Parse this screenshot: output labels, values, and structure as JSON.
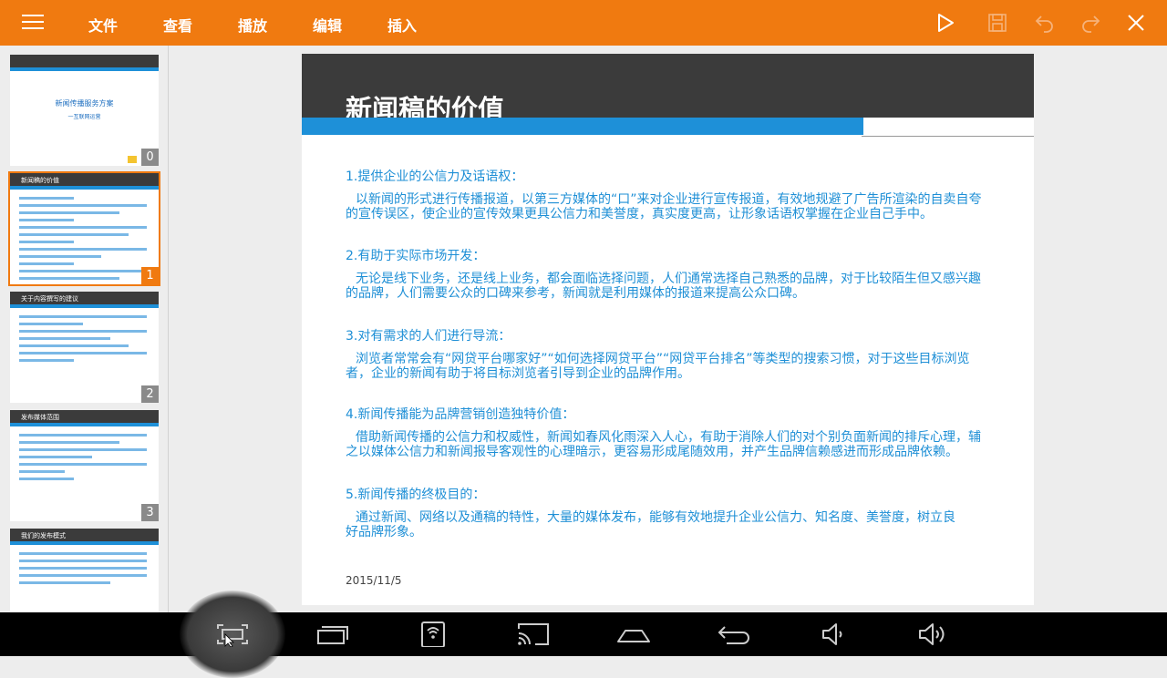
{
  "menu": {
    "items": [
      "文件",
      "查看",
      "播放",
      "编辑",
      "插入"
    ]
  },
  "toolbar": {
    "icons": [
      "play-icon",
      "save-icon",
      "undo-icon",
      "redo-icon",
      "close-icon"
    ]
  },
  "thumbnails": [
    {
      "index": "0",
      "title": "新闻传播服务方案",
      "subtitle": "一互联网运营"
    },
    {
      "index": "1",
      "title": "新闻稿的价值"
    },
    {
      "index": "2",
      "title": "关于内容撰写的建议"
    },
    {
      "index": "3",
      "title": "发布媒体范围"
    },
    {
      "index": "",
      "title": "我们的发布模式"
    }
  ],
  "slide": {
    "title": "新闻稿的价值",
    "sections": [
      {
        "heading": "1.提供企业的公信力及话语权：",
        "body": "以新闻的形式进行传播报道，以第三方媒体的“口”来对企业进行宣传报道，有效地规避了广告所渲染的自卖自夸的宣传误区，使企业的宣传效果更具公信力和美誉度，真实度更高，让形象话语权掌握在企业自己手中。"
      },
      {
        "heading": "2.有助于实际市场开发：",
        "body": "无论是线下业务，还是线上业务，都会面临选择问题，人们通常选择自己熟悉的品牌，对于比较陌生但又感兴趣的品牌，人们需要公众的口碑来参考，新闻就是利用媒体的报道来提高公众口碑。"
      },
      {
        "heading": "3.对有需求的人们进行导流：",
        "body": "浏览者常常会有“网贷平台哪家好”“如何选择网贷平台”“网贷平台排名”等类型的搜索习惯，对于这些目标浏览者，企业的新闻有助于将目标浏览者引导到企业的品牌作用。"
      },
      {
        "heading": "4.新闻传播能为品牌营销创造独特价值：",
        "body": "借助新闻传播的公信力和权威性，新闻如春风化雨深入人心，有助于消除人们的对个别负面新闻的排斥心理，辅之以媒体公信力和新闻报导客观性的心理暗示，更容易形成尾随效用，并产生品牌信赖感进而形成品牌依赖。"
      },
      {
        "heading": "5.新闻传播的终极目的：",
        "body": "通过新闻、网络以及通稿的特性，大量的媒体发布，能够有效地提升企业公信力、知名度、美誉度，树立良好品牌形象。"
      }
    ],
    "date": "2015/11/5"
  },
  "navbar": {
    "icons": [
      "screenshot-icon",
      "recent-apps-icon",
      "wifi-phone-icon",
      "cast-icon",
      "home-icon",
      "back-icon",
      "volume-down-icon",
      "volume-up-icon"
    ]
  },
  "colors": {
    "accent": "#f07a10",
    "slide_text": "#1e8fd6",
    "slide_header": "#3b3b3b",
    "band": "#1e90d8"
  }
}
